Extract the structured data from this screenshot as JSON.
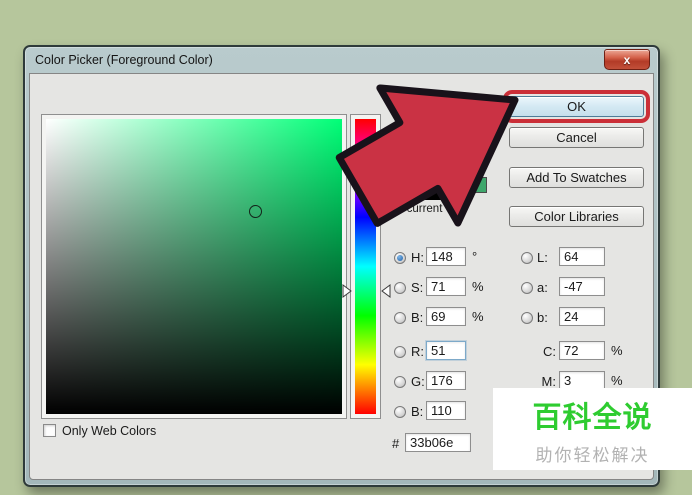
{
  "window": {
    "title": "Color Picker (Foreground Color)",
    "close_glyph": "x"
  },
  "swatches": {
    "current_label": "current",
    "new_color": "#33b06e",
    "current_color": "#000000"
  },
  "sliders": {
    "hue_degrees": 148
  },
  "fields": {
    "hsb": [
      {
        "label": "H:",
        "value": "148",
        "unit": "°",
        "selected": true
      },
      {
        "label": "S:",
        "value": "71",
        "unit": "%",
        "selected": false
      },
      {
        "label": "B:",
        "value": "69",
        "unit": "%",
        "selected": false
      }
    ],
    "rgb": [
      {
        "label": "R:",
        "value": "51"
      },
      {
        "label": "G:",
        "value": "176"
      },
      {
        "label": "B:",
        "value": "110"
      }
    ],
    "lab": [
      {
        "label": "L:",
        "value": "64"
      },
      {
        "label": "a:",
        "value": "-47"
      },
      {
        "label": "b:",
        "value": "24"
      }
    ],
    "cmyk": [
      {
        "label": "C:",
        "value": "72",
        "unit": "%"
      },
      {
        "label": "M:",
        "value": "3",
        "unit": "%"
      }
    ],
    "hex": {
      "label": "#",
      "value": "33b06e"
    }
  },
  "buttons": {
    "ok": "OK",
    "cancel": "Cancel",
    "add_to_swatches": "Add To Swatches",
    "color_libraries": "Color Libraries"
  },
  "checkbox": {
    "label": "Only Web Colors",
    "checked": false
  },
  "watermark": {
    "title": "百科全说",
    "subtitle": "助你轻松解决"
  },
  "colors": {
    "annotation_red": "#ca3244",
    "watermark_green": "#2ecc30"
  }
}
